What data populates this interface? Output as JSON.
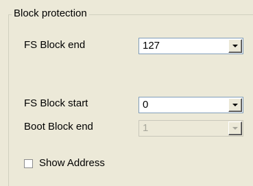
{
  "group": {
    "title": "Block protection"
  },
  "fs_block_end": {
    "label": "FS Block end",
    "value": "127",
    "enabled": true
  },
  "fs_block_start": {
    "label": "FS Block start",
    "value": "0",
    "enabled": true
  },
  "boot_block_end": {
    "label": "Boot Block end",
    "value": "1",
    "enabled": false
  },
  "show_address": {
    "label": "Show Address",
    "checked": false
  },
  "icons": {
    "dropdown": "chevron-down-icon"
  }
}
